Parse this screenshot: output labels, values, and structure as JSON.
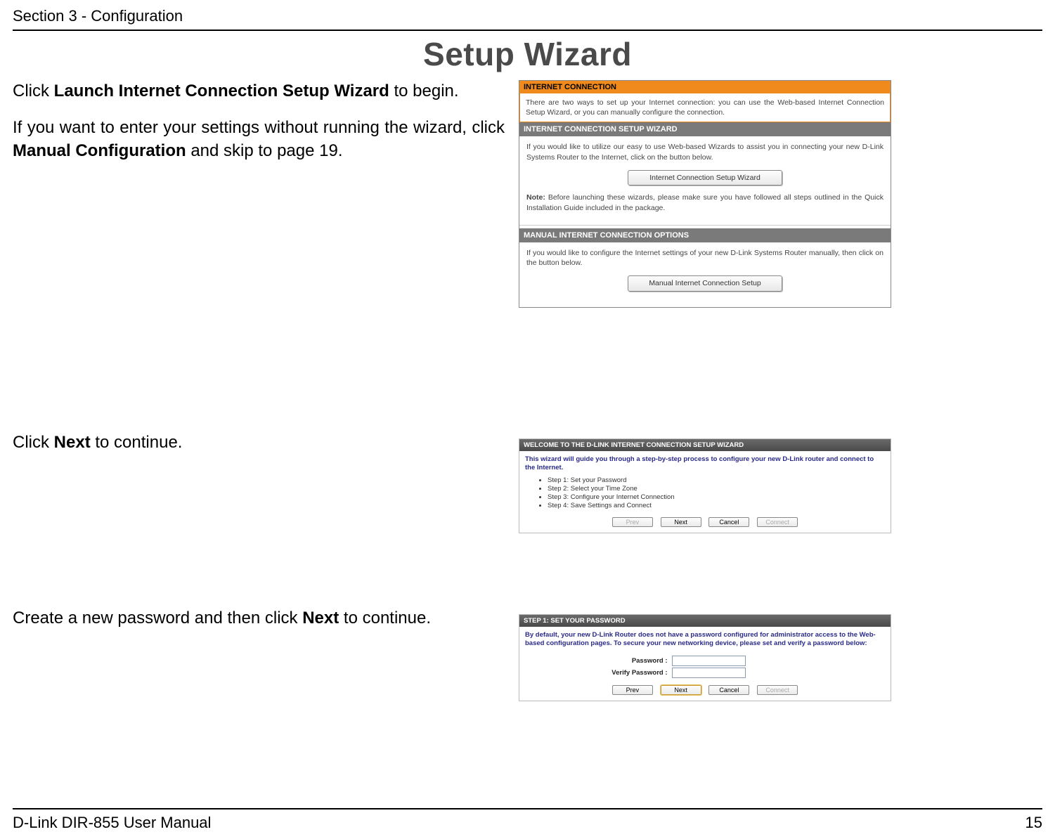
{
  "header": {
    "section": "Section 3 - Configuration"
  },
  "title": "Setup Wizard",
  "para1": {
    "pre": "Click ",
    "bold": "Launch Internet Connection Setup Wizard",
    "post": " to begin."
  },
  "para2": {
    "pre": "If you want to enter your settings without running the wizard, click ",
    "bold": "Manual Configuration",
    "post": " and skip to page 19."
  },
  "para3": {
    "pre": "Click ",
    "bold": "Next",
    "post": " to continue."
  },
  "para4": {
    "pre": "Create a new password and then click ",
    "bold": "Next",
    "post": " to continue."
  },
  "ss1": {
    "orange_title": "INTERNET CONNECTION",
    "orange_body": "There are two ways to set up your Internet connection: you can use the Web-based Internet Connection Setup Wizard, or you can manually configure the connection.",
    "wizard_title": "INTERNET CONNECTION SETUP WIZARD",
    "wizard_body": "If you would like to utilize our easy to use Web-based Wizards to assist you in connecting your new D-Link Systems Router to the Internet, click on the button below.",
    "wizard_btn": "Internet Connection Setup Wizard",
    "note_label": "Note:",
    "note_body": " Before launching these wizards, please make sure you have followed all steps outlined in the Quick Installation Guide included in the package.",
    "manual_title": "MANUAL INTERNET CONNECTION OPTIONS",
    "manual_body": "If you would like to configure the Internet settings of your new D-Link Systems Router manually, then click on the button below.",
    "manual_btn": "Manual Internet Connection Setup"
  },
  "ss2": {
    "title": "WELCOME TO THE D-LINK INTERNET CONNECTION SETUP WIZARD",
    "intro": "This wizard will guide you through a step-by-step process to configure your new D-Link router and connect to the Internet.",
    "steps": [
      "Step 1: Set your Password",
      "Step 2: Select your Time Zone",
      "Step 3: Configure your Internet Connection",
      "Step 4: Save Settings and Connect"
    ],
    "btn_prev": "Prev",
    "btn_next": "Next",
    "btn_cancel": "Cancel",
    "btn_connect": "Connect"
  },
  "ss3": {
    "title": "STEP 1: SET YOUR PASSWORD",
    "intro": "By default, your new D-Link Router does not have a password configured for administrator access to the Web-based configuration pages. To secure your new networking device, please set and verify a password below:",
    "lbl_pwd": "Password :",
    "lbl_vpwd": "Verify Password :",
    "btn_prev": "Prev",
    "btn_next": "Next",
    "btn_cancel": "Cancel",
    "btn_connect": "Connect"
  },
  "footer": {
    "left": "D-Link DIR-855 User Manual",
    "right": "15"
  }
}
